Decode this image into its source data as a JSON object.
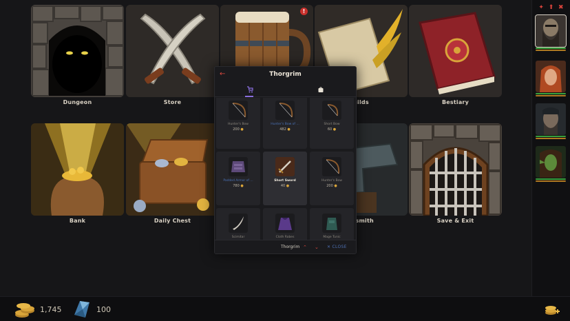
{
  "locations": [
    {
      "label": "Dungeon"
    },
    {
      "label": "Store"
    },
    {
      "label": "",
      "alert": "!"
    },
    {
      "label": "uilds"
    },
    {
      "label": "Bestiary"
    },
    {
      "label": "Bank"
    },
    {
      "label": "Daily Chest"
    },
    {
      "label": "cksmith"
    },
    {
      "label": "Save & Exit"
    }
  ],
  "sidebar": {
    "top_icons": [
      "add-hero-icon",
      "hero-upgrade-icon",
      "delete-icon"
    ],
    "heroes": [
      {
        "name": "Thorgrim",
        "selected": true,
        "icon": "dwarf-portrait-icon"
      },
      {
        "name": "",
        "icon": "elf-woman-portrait-icon"
      },
      {
        "name": "",
        "icon": "dark-warrior-portrait-icon"
      },
      {
        "name": "",
        "icon": "green-elf-portrait-icon"
      }
    ]
  },
  "resources": {
    "gold": "1,745",
    "crystals": "100"
  },
  "modal": {
    "back_icon": "arrow-left-icon",
    "title": "Thorgrim",
    "tabs": [
      {
        "icon": "cart-icon",
        "active": true
      },
      {
        "icon": "bag-icon",
        "active": false
      }
    ],
    "items": [
      {
        "name": "Hunter's Bow",
        "price": "200",
        "style": "normal",
        "icon": "bow-icon"
      },
      {
        "name": "Hunter's Bow of ...",
        "price": "482",
        "style": "rare",
        "icon": "bow-icon"
      },
      {
        "name": "Short Bow",
        "price": "60",
        "style": "normal",
        "icon": "bow-icon"
      },
      {
        "name": "Padded Armor of ...",
        "price": "780",
        "style": "rare",
        "icon": "armor-icon"
      },
      {
        "name": "Short Sword",
        "price": "40",
        "style": "highlight",
        "icon": "sword-icon"
      },
      {
        "name": "Hunter's Bow",
        "price": "200",
        "style": "normal",
        "icon": "bow-icon"
      },
      {
        "name": "Scimitar",
        "price": "",
        "style": "normal",
        "icon": "scimitar-icon"
      },
      {
        "name": "Cloth Robes",
        "price": "",
        "style": "normal",
        "icon": "robe-icon"
      },
      {
        "name": "Mage Tunic",
        "price": "",
        "style": "normal",
        "icon": "tunic-icon"
      }
    ],
    "footer": {
      "hero_name": "Thorgrim",
      "close_label": "CLOSE"
    }
  },
  "colors": {
    "accent": "#e0493f",
    "rare": "#4a73b8",
    "gold": "#d9a53a",
    "tab_indicator": "#8a6fe0"
  }
}
